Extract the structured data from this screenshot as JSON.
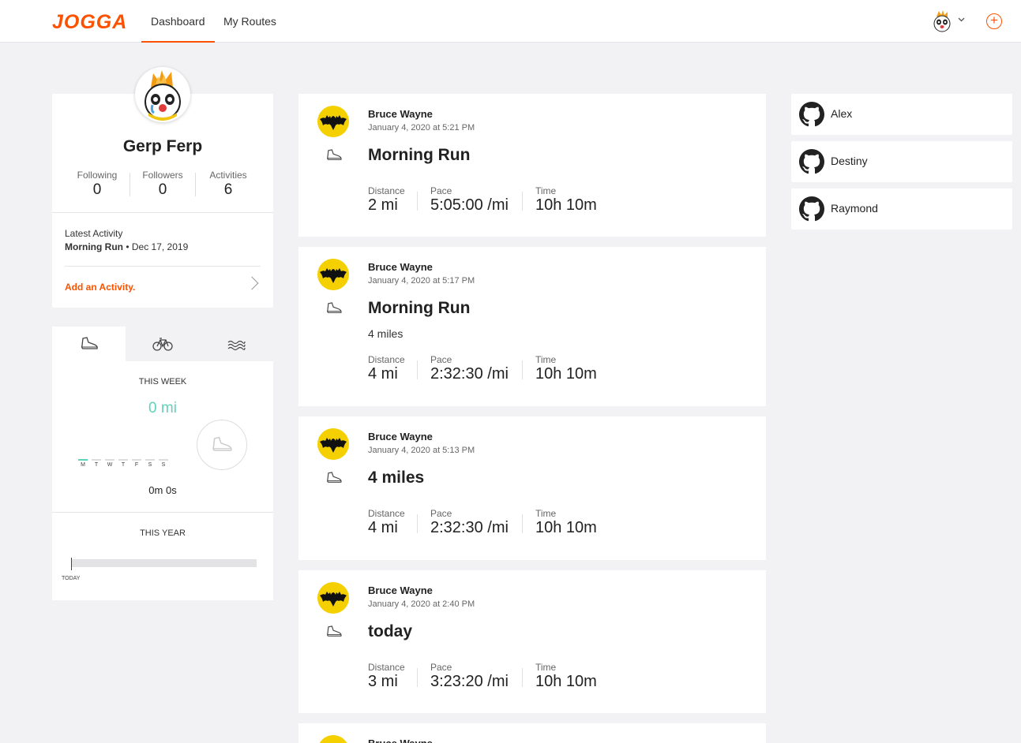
{
  "nav": {
    "logo": "JOGGA",
    "tabs": [
      {
        "label": "Dashboard",
        "active": true
      },
      {
        "label": "My Routes",
        "active": false
      }
    ],
    "accent": "#fc5200"
  },
  "profile": {
    "name": "Gerp Ferp",
    "stats": [
      {
        "label": "Following",
        "value": "0"
      },
      {
        "label": "Followers",
        "value": "0"
      },
      {
        "label": "Activities",
        "value": "6"
      }
    ],
    "latest_label": "Latest Activity",
    "latest_activity": "Morning Run",
    "latest_date": " • Dec 17, 2019",
    "add_activity": "Add an Activity."
  },
  "sport_stats": {
    "tabs": [
      "run-icon",
      "bike-icon",
      "swim-icon"
    ],
    "this_week_label": "THIS WEEK",
    "this_week_distance": "0 mi",
    "days": [
      "M",
      "T",
      "W",
      "T",
      "F",
      "S",
      "S"
    ],
    "this_week_time": "0m 0s",
    "this_year_label": "THIS YEAR",
    "today_label": "TODAY",
    "week_color": "#5fd3b6"
  },
  "feed": [
    {
      "author": "Bruce Wayne",
      "date": "January 4, 2020 at 5:21 PM",
      "title": "Morning Run",
      "description": "",
      "distance_label": "Distance",
      "distance": "2 mi",
      "pace_label": "Pace",
      "pace": "5:05:00 /mi",
      "time_label": "Time",
      "time": "10h 10m"
    },
    {
      "author": "Bruce Wayne",
      "date": "January 4, 2020 at 5:17 PM",
      "title": "Morning Run",
      "description": "4 miles",
      "distance_label": "Distance",
      "distance": "4 mi",
      "pace_label": "Pace",
      "pace": "2:32:30 /mi",
      "time_label": "Time",
      "time": "10h 10m"
    },
    {
      "author": "Bruce Wayne",
      "date": "January 4, 2020 at 5:13 PM",
      "title": "4 miles",
      "description": "",
      "distance_label": "Distance",
      "distance": "4 mi",
      "pace_label": "Pace",
      "pace": "2:32:30 /mi",
      "time_label": "Time",
      "time": "10h 10m"
    },
    {
      "author": "Bruce Wayne",
      "date": "January 4, 2020 at 2:40 PM",
      "title": "today",
      "description": "",
      "distance_label": "Distance",
      "distance": "3 mi",
      "pace_label": "Pace",
      "pace": "3:23:20 /mi",
      "time_label": "Time",
      "time": "10h 10m"
    },
    {
      "author": "Bruce Wayne"
    }
  ],
  "friends": [
    {
      "name": "Alex"
    },
    {
      "name": "Destiny"
    },
    {
      "name": "Raymond"
    }
  ]
}
